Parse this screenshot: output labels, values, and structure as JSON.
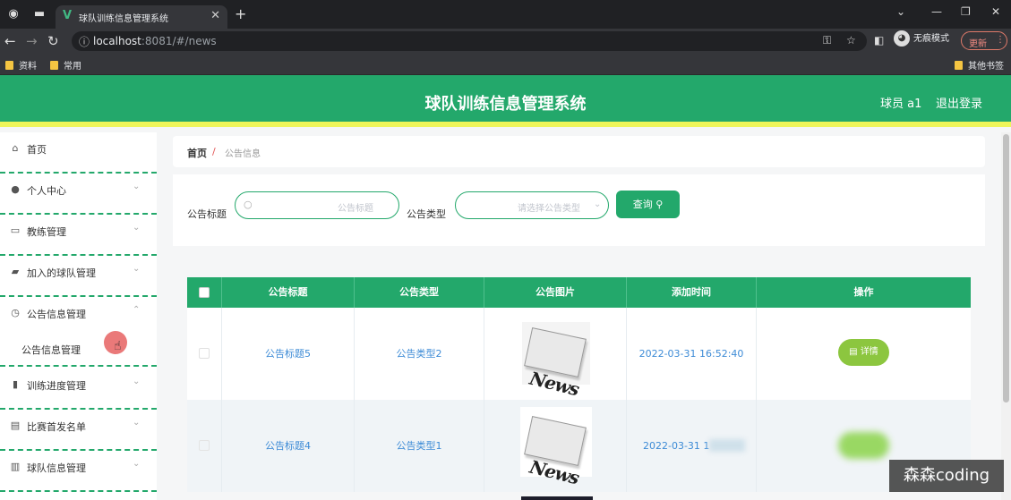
{
  "browser": {
    "tab_title": "球队训练信息管理系统",
    "url_host": "localhost",
    "url_path": ":8081/#/news",
    "incognito_label": "无痕模式",
    "update_label": "更新",
    "bookmarks": [
      "资料",
      "常用"
    ],
    "bookmarks_right": "其他书签"
  },
  "header": {
    "title": "球队训练信息管理系统",
    "user": "球员 a1",
    "logout": "退出登录"
  },
  "sidebar": {
    "items": [
      {
        "label": "首页",
        "icon": "home-icon"
      },
      {
        "label": "个人中心",
        "icon": "user-icon"
      },
      {
        "label": "教练管理",
        "icon": "id-card-icon"
      },
      {
        "label": "加入的球队管理",
        "icon": "ticket-icon"
      },
      {
        "label": "公告信息管理",
        "icon": "clock-icon"
      },
      {
        "label": "训练进度管理",
        "icon": "bar-chart-icon"
      },
      {
        "label": "比赛首发名单",
        "icon": "briefcase-icon"
      },
      {
        "label": "球队信息管理",
        "icon": "book-icon"
      }
    ],
    "sub_item": "公告信息管理"
  },
  "breadcrumb": {
    "home": "首页",
    "sep": "/",
    "current": "公告信息"
  },
  "search": {
    "title_label": "公告标题",
    "title_placeholder": "公告标题",
    "type_label": "公告类型",
    "type_placeholder": "请选择公告类型",
    "query_label": "查询"
  },
  "table": {
    "headers": [
      "公告标题",
      "公告类型",
      "公告图片",
      "添加时间",
      "操作"
    ],
    "rows": [
      {
        "title": "公告标题5",
        "type": "公告类型2",
        "image_text": "News",
        "time": "2022-03-31 16:52:40",
        "action": "详情"
      },
      {
        "title": "公告标题4",
        "type": "公告类型1",
        "image_text": "News",
        "time": "2022-03-31 1",
        "action": ""
      }
    ]
  },
  "watermark": "森森coding"
}
